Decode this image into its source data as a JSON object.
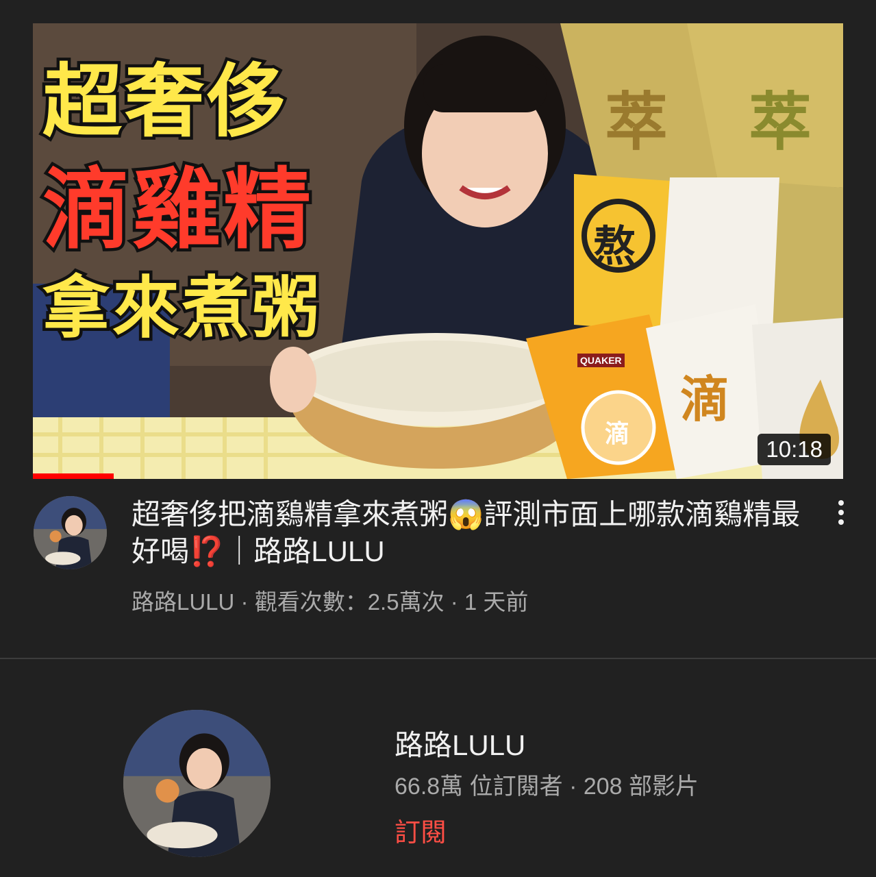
{
  "video": {
    "thumbnail": {
      "headline_line1": "超奢侈",
      "headline_line2": "滴雞精",
      "headline_line3": "拿來煮粥",
      "pack_text_1": "萃",
      "pack_text_2": "萃",
      "pack_text_3": "熬",
      "pack_text_4": "滴",
      "pack_text_5": "滴",
      "pack_brand": "QUAKER",
      "duration": "10:18",
      "watch_progress": 0.1
    },
    "title": "超奢侈把滴鷄精拿來煮粥😱評測市面上哪款滴鷄精最好喝⁉️｜路路LULU",
    "meta": "路路LULU · 觀看次數：2.5萬次 · 1 天前"
  },
  "channel": {
    "name": "路路LULU",
    "stats": "66.8萬 位訂閱者 · 208 部影片",
    "subscribe_label": "訂閱"
  },
  "colors": {
    "background": "#212121",
    "headline_yellow": "#ffe84a",
    "headline_red": "#ff3b2b",
    "subscribe": "#ff4e45",
    "progress": "#ff0000"
  },
  "icons": {
    "more": "more-vert-icon"
  }
}
